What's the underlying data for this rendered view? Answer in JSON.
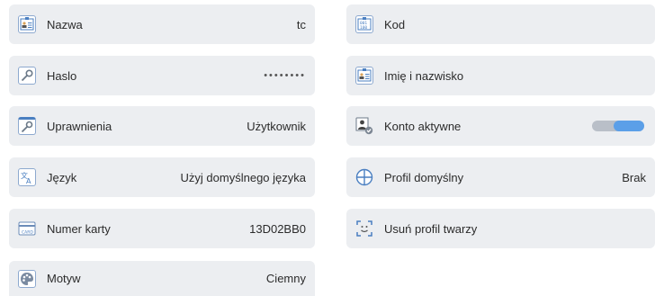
{
  "left_column": [
    {
      "label": "Nazwa",
      "value": "tc",
      "icon": "id-card-icon"
    },
    {
      "label": "Haslo",
      "value": "••••••••",
      "icon": "key-icon"
    },
    {
      "label": "Uprawnienia",
      "value": "Użytkownik",
      "icon": "permissions-key-icon"
    },
    {
      "label": "Język",
      "value": "Użyj domyślnego języka",
      "icon": "translate-icon"
    },
    {
      "label": "Numer karty",
      "value": "13D02BB0",
      "icon": "card-icon"
    },
    {
      "label": "Motyw",
      "value": "Ciemny",
      "icon": "palette-icon"
    }
  ],
  "right_column": [
    {
      "label": "Kod",
      "icon": "binary-code-icon"
    },
    {
      "label": "Imię i nazwisko",
      "icon": "id-card-icon"
    },
    {
      "label": "Konto aktywne",
      "toggle_on": true,
      "icon": "user-check-icon"
    },
    {
      "label": "Profil domyślny",
      "value": "Brak",
      "icon": "globe-icon"
    },
    {
      "label": "Usuń profil twarzy",
      "icon": "face-scan-icon"
    }
  ],
  "colors": {
    "tile_bg": "#eceef1",
    "icon_border": "#8da9cf",
    "toggle_on": "#4a90e2",
    "toggle_track": "#b9bfc8"
  }
}
